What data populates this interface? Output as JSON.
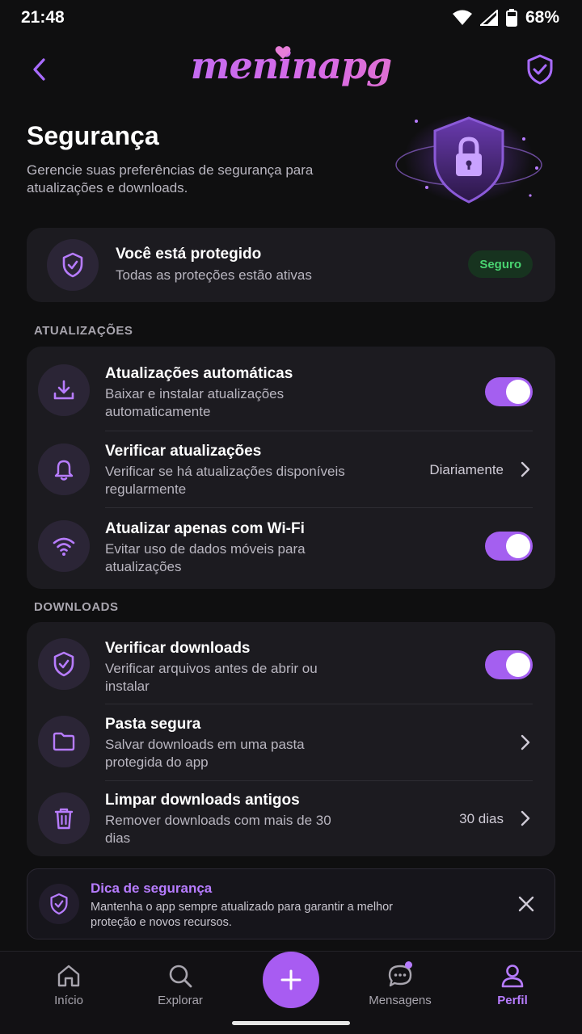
{
  "status_bar": {
    "time": "21:48",
    "battery": "68%"
  },
  "header": {
    "logo": "meninapg"
  },
  "page": {
    "title": "Segurança",
    "description": "Gerencie suas preferências de segurança para atualizações e downloads."
  },
  "status_card": {
    "title": "Você está protegido",
    "subtitle": "Todas as proteções estão ativas",
    "badge": "Seguro"
  },
  "sections": {
    "updates": {
      "label": "ATUALIZAÇÕES",
      "items": [
        {
          "title": "Atualizações automáticas",
          "subtitle": "Baixar e instalar atualizações automaticamente",
          "icon": "download-icon",
          "toggle": true
        },
        {
          "title": "Verificar atualizações",
          "subtitle": "Verificar se há atualizações disponíveis regularmente",
          "icon": "bell-icon",
          "value": "Diariamente"
        },
        {
          "title": "Atualizar apenas com Wi-Fi",
          "subtitle": "Evitar uso de dados móveis para atualizações",
          "icon": "wifi-icon",
          "toggle": true
        }
      ]
    },
    "downloads": {
      "label": "DOWNLOADS",
      "items": [
        {
          "title": "Verificar downloads",
          "subtitle": "Verificar arquivos antes de abrir ou instalar",
          "icon": "shield-check-icon",
          "toggle": true
        },
        {
          "title": "Pasta segura",
          "subtitle": "Salvar downloads em uma pasta protegida do app",
          "icon": "folder-icon"
        },
        {
          "title": "Limpar downloads antigos",
          "subtitle": "Remover downloads com mais de 30 dias",
          "icon": "trash-icon",
          "value": "30 dias"
        }
      ]
    }
  },
  "tip": {
    "title": "Dica de segurança",
    "body": "Mantenha o app sempre atualizado para garantir a melhor proteção e novos recursos."
  },
  "nav": {
    "items": [
      {
        "label": "Início",
        "icon": "home-icon"
      },
      {
        "label": "Explorar",
        "icon": "search-icon"
      },
      {
        "label": "Mensagens",
        "icon": "chat-icon"
      },
      {
        "label": "Perfil",
        "icon": "user-icon"
      }
    ]
  },
  "colors": {
    "accent": "#a85cf2",
    "background": "#0f0f10",
    "card": "#1c1b20",
    "success": "#49d370"
  }
}
